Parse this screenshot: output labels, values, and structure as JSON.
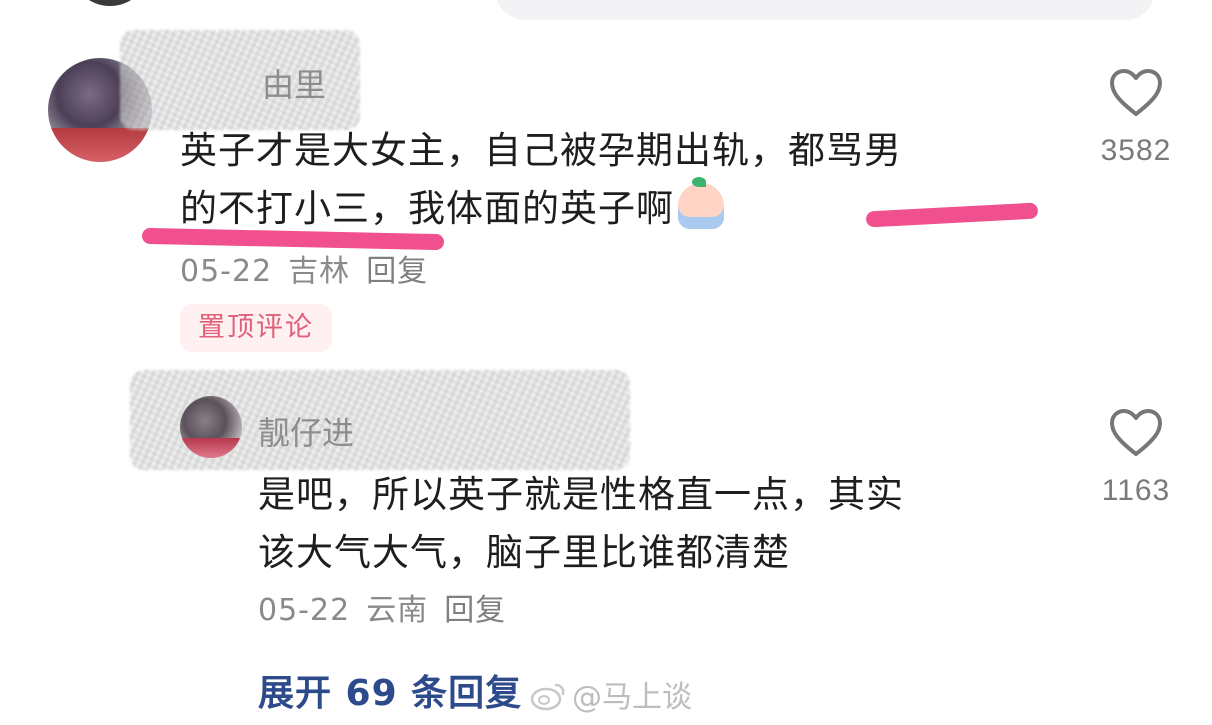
{
  "comments": [
    {
      "username": "由里",
      "text_line1": "英子才是大女主，自己被孕期出轨，都骂男",
      "text_line2": "的不打小三，我体面的英子啊",
      "emoji": "peach-face-emoji",
      "date": "05-22",
      "location": "吉林",
      "reply_label": "回复",
      "badge": "置顶评论",
      "likes": "3582"
    },
    {
      "username": "靓仔进",
      "text_line1": "是吧，所以英子就是性格直一点，其实",
      "text_line2": "该大气大气，脑子里比谁都清楚",
      "date": "05-22",
      "location": "云南",
      "reply_label": "回复",
      "likes": "1163"
    }
  ],
  "expand_replies": "展开 69 条回复",
  "watermark": "@马上谈",
  "colors": {
    "highlight": "#f0508d",
    "badge_text": "#e0607a",
    "badge_bg": "#fff0f2",
    "link": "#2d4a8a",
    "meta": "#8a8a8a"
  },
  "icons": [
    "heart-outline-icon",
    "weibo-logo-icon"
  ]
}
